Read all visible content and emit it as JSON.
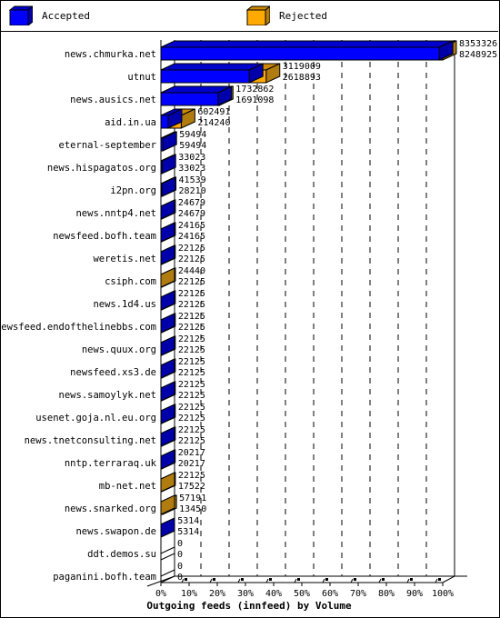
{
  "chart_data": {
    "type": "bar",
    "orientation": "horizontal",
    "stacked": true,
    "title": "Outgoing feeds (innfeed) by Volume",
    "xlabel": "Outgoing feeds (innfeed) by Volume",
    "ylabel": "",
    "xlim": [
      0,
      100
    ],
    "x_unit": "%",
    "x_ticks": [
      "0%",
      "10%",
      "20%",
      "30%",
      "40%",
      "50%",
      "60%",
      "70%",
      "80%",
      "90%",
      "100%"
    ],
    "grid": true,
    "legend_position": "top",
    "legend": [
      {
        "name": "Accepted",
        "color": "#0000ff"
      },
      {
        "name": "Rejected",
        "color": "#ffaa00"
      }
    ],
    "max_total": 8353326,
    "categories": [
      "news.chmurka.net",
      "utnut",
      "news.ausics.net",
      "aid.in.ua",
      "eternal-september",
      "news.hispagatos.org",
      "i2pn.org",
      "news.nntp4.net",
      "newsfeed.bofh.team",
      "weretis.net",
      "csiph.com",
      "news.1d4.us",
      "newsfeed.endofthelinebbs.com",
      "news.quux.org",
      "newsfeed.xs3.de",
      "news.samoylyk.net",
      "usenet.goja.nl.eu.org",
      "news.tnetconsulting.net",
      "nntp.terraraq.uk",
      "mb-net.net",
      "news.snarked.org",
      "news.swapon.de",
      "ddt.demos.su",
      "paganini.bofh.team"
    ],
    "totals": [
      8353326,
      3119009,
      1732862,
      602491,
      59494,
      33023,
      41539,
      24679,
      24165,
      22125,
      24440,
      22125,
      22125,
      22125,
      22125,
      22125,
      22125,
      22125,
      20217,
      22125,
      57191,
      5314,
      0,
      0
    ],
    "accepted": [
      8248925,
      2618893,
      1691098,
      214240,
      59494,
      33023,
      28210,
      24679,
      24165,
      22125,
      22125,
      22125,
      22125,
      22125,
      22125,
      22125,
      22125,
      22125,
      20217,
      17522,
      13450,
      5314,
      0,
      0
    ],
    "series": [
      {
        "name": "Accepted",
        "color": "#0000ff"
      },
      {
        "name": "Rejected",
        "color": "#ffaa00"
      }
    ]
  },
  "colors": {
    "accepted_front": "#0000ff",
    "accepted_top": "#0000cc",
    "accepted_side": "#0000aa",
    "rejected_front": "#ffaa00",
    "rejected_top": "#cc8800",
    "rejected_side": "#b07c10"
  }
}
